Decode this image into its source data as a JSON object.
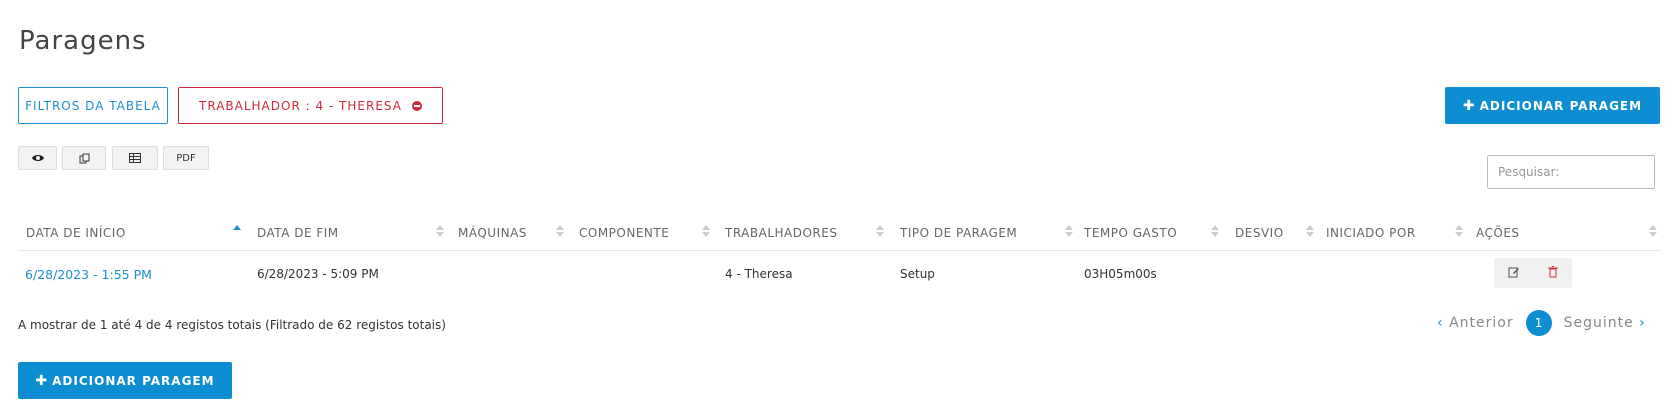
{
  "page_title": "Paragens",
  "filters_button": "FILTROS DA TABELA",
  "worker_filter": "TRABALHADOR : 4 - THERESA",
  "add_button_top": "ADICIONAR PARAGEM",
  "add_button_bottom": "ADICIONAR PARAGEM",
  "export": {
    "view_icon": "eye-icon",
    "copy_icon": "copy-icon",
    "excel_icon": "table-icon",
    "pdf_label": "PDF"
  },
  "search": {
    "placeholder": "Pesquisar:"
  },
  "columns": [
    "DATA DE INÍCIO",
    "DATA DE FIM",
    "MÁQUINAS",
    "COMPONENTE",
    "TRABALHADORES",
    "TIPO DE PARAGEM",
    "TEMPO GASTO",
    "DESVIO",
    "INICIADO POR",
    "AÇÕES"
  ],
  "sorted_column": "DATA DE INÍCIO",
  "rows": [
    {
      "start": "6/28/2023 - 1:55 PM",
      "end": "6/28/2023 - 5:09 PM",
      "machines": "",
      "component": "",
      "workers": "4 - Theresa",
      "stop_type": "Setup",
      "time_spent": "03H05m00s",
      "deviation": "",
      "started_by": "",
      "actions": {
        "edit_icon": "edit-icon",
        "delete_icon": "trash-icon"
      }
    }
  ],
  "table_info": "A mostrar de 1 até 4 de 4 registos totais (Filtrado de 62 registos totais)",
  "pagination": {
    "prev_label": "Anterior",
    "current_page": "1",
    "next_label": "Seguinte"
  },
  "colors": {
    "primary": "#0e8ed2",
    "danger": "#d02a3a",
    "link": "#1b8fd0"
  }
}
